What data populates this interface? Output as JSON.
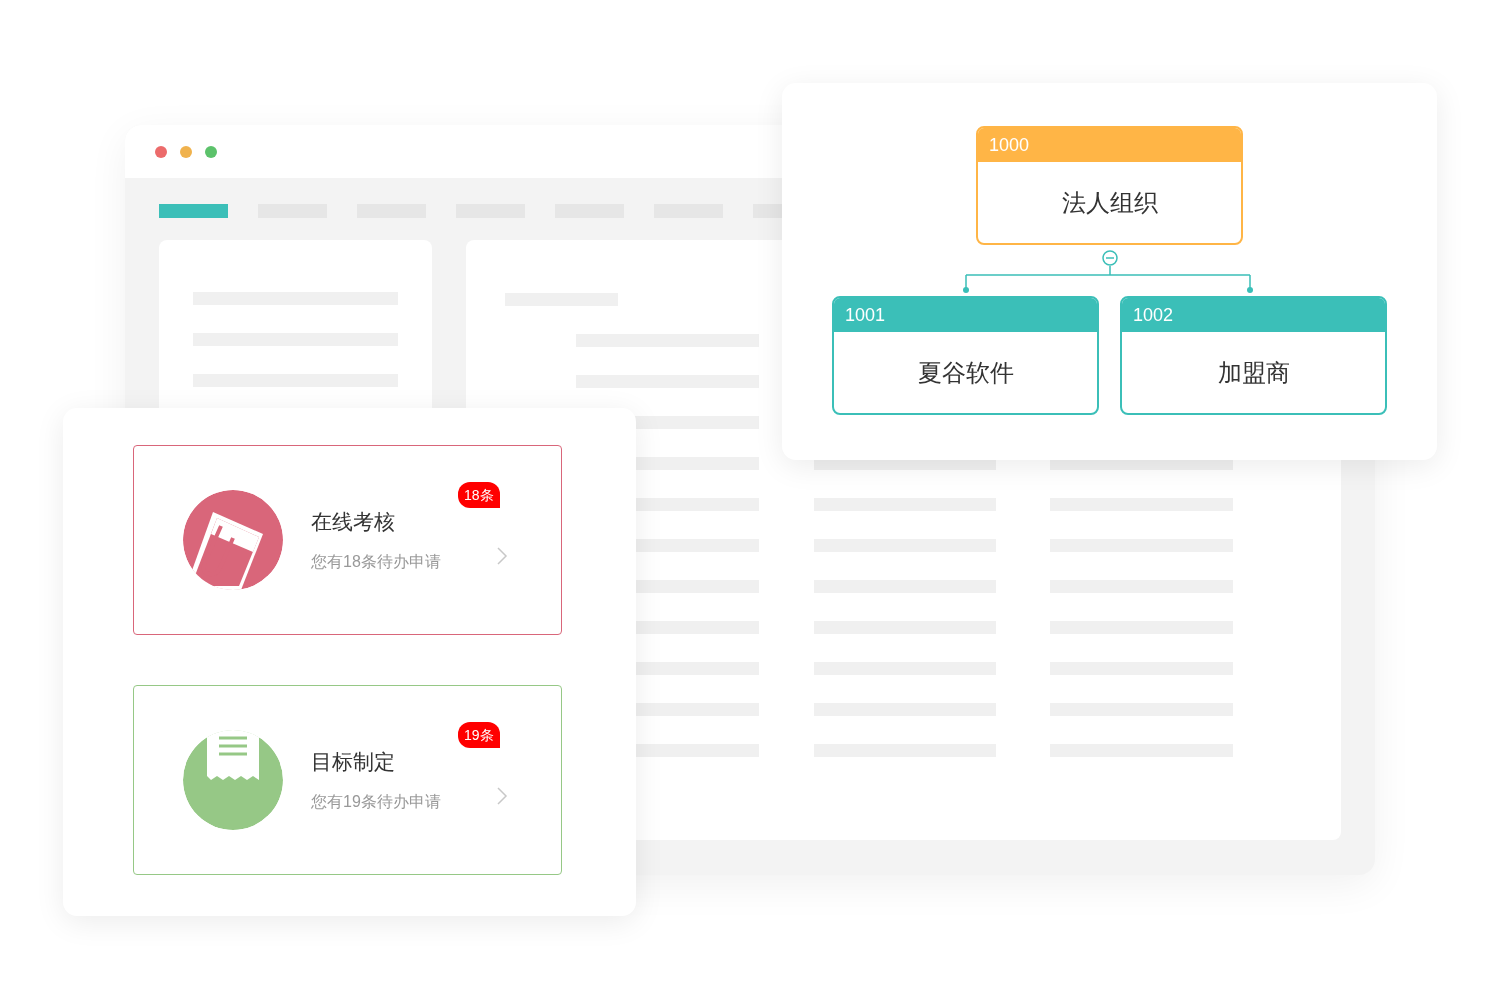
{
  "background_window": {
    "tabs": [
      {
        "selected": true
      },
      {
        "selected": false
      },
      {
        "selected": false
      },
      {
        "selected": false
      },
      {
        "selected": false
      },
      {
        "selected": false
      },
      {
        "selected": false
      }
    ]
  },
  "task_cards": [
    {
      "kind": "paperclip",
      "title": "在线考核",
      "subtitle": "您有18条待办申请",
      "badge": "18条",
      "color": "#d9667a"
    },
    {
      "kind": "receipt",
      "title": "目标制定",
      "subtitle": "您有19条待办申请",
      "badge": "19条",
      "color": "#96c886"
    }
  ],
  "org_chart": {
    "code": "1000",
    "name": "法人组织",
    "expanded": true,
    "children": [
      {
        "code": "1001",
        "name": "夏谷软件"
      },
      {
        "code": "1002",
        "name": "加盟商"
      }
    ]
  }
}
